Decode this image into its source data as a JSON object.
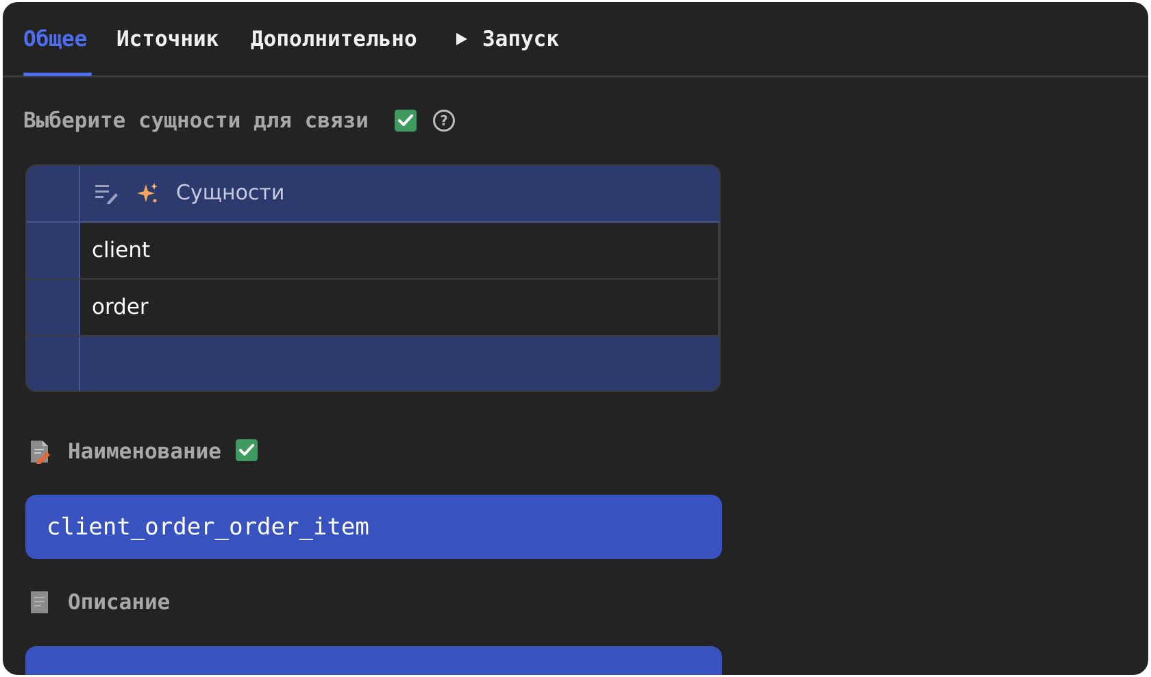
{
  "tabs": [
    {
      "label": "Общее",
      "active": true
    },
    {
      "label": "Источник",
      "active": false
    },
    {
      "label": "Дополнительно",
      "active": false
    },
    {
      "label": "Запуск",
      "active": false,
      "icon": "play-icon"
    }
  ],
  "entities_section": {
    "label": "Выберите сущности для связи",
    "status_icon": "check-icon",
    "help_icon": "help-icon"
  },
  "entities_table": {
    "header_icons": [
      "edit-list-icon",
      "sparkle-icon"
    ],
    "header": "Сущности",
    "rows": [
      "client",
      "order"
    ]
  },
  "name_section": {
    "label": "Наименование",
    "icon": "doc-edit-icon",
    "status_icon": "check-icon",
    "value": "client_order_order_item"
  },
  "description_section": {
    "label": "Описание",
    "icon": "doc-icon",
    "value": ""
  },
  "colors": {
    "background": "#232323",
    "accent": "#4d6ef0",
    "field": "#3853c0",
    "table_header": "#2d3a6d",
    "check": "#3f9a5f"
  }
}
